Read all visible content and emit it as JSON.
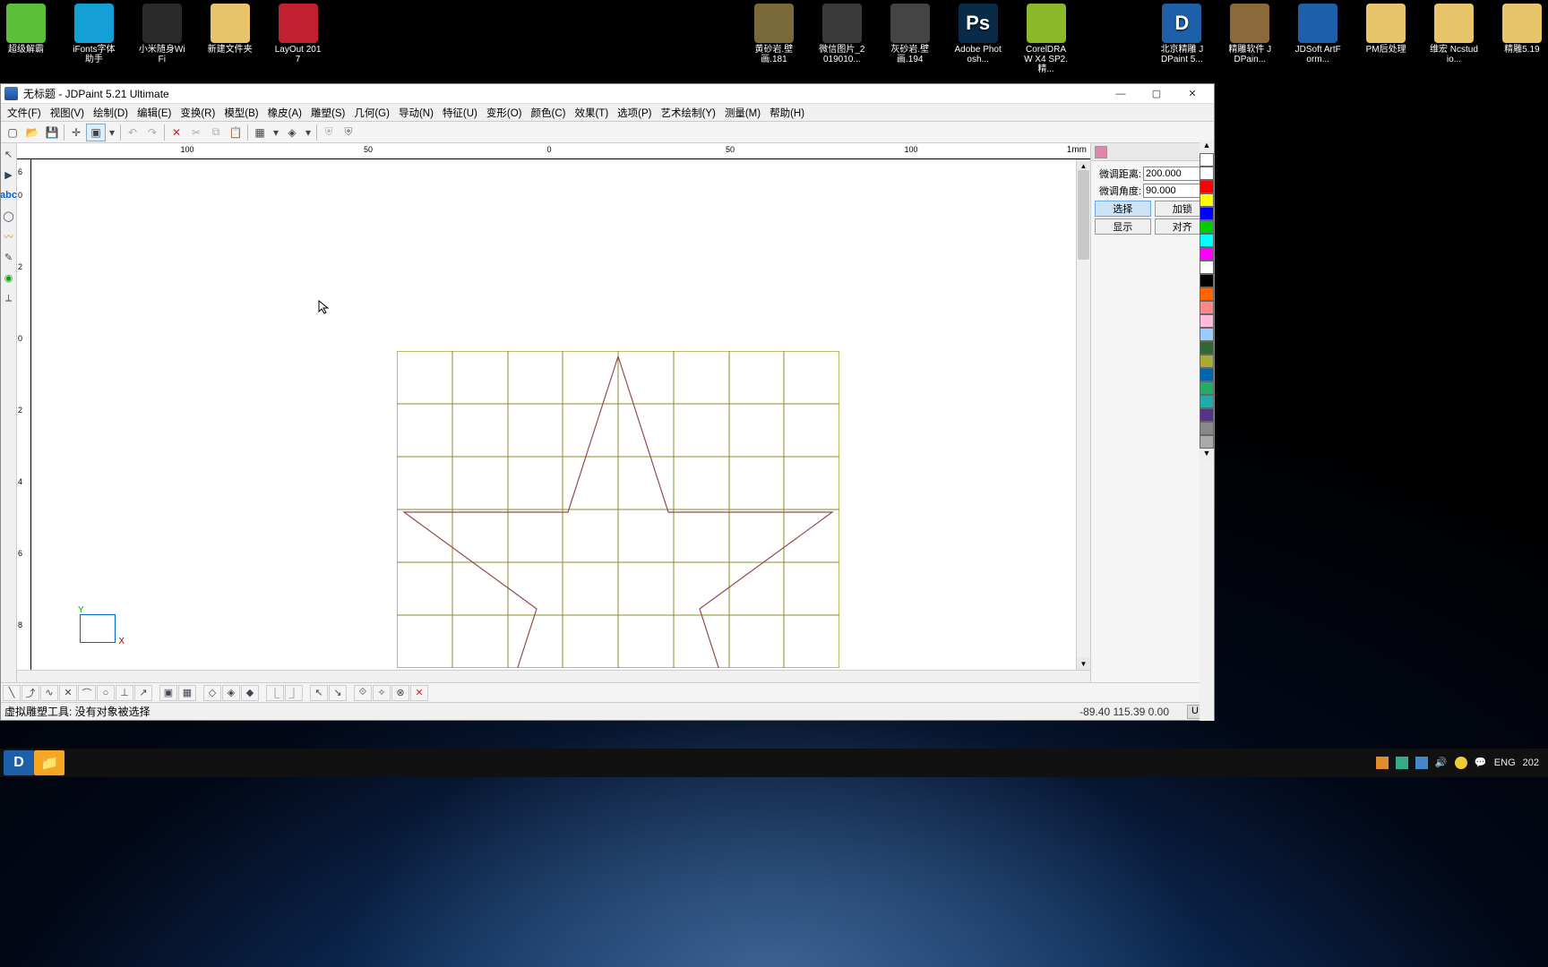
{
  "desktop_icons": [
    {
      "label": "超级解霸",
      "color": "#5bbf3a"
    },
    {
      "label": "iFonts字体助手",
      "color": "#14a0d6"
    },
    {
      "label": "小米随身WiFi",
      "color": "#2a2a2a"
    },
    {
      "label": "新建文件夹",
      "color": "#e8c46a"
    },
    {
      "label": "LayOut 2017",
      "color": "#c02030"
    },
    {
      "label": "",
      "color": "transparent"
    },
    {
      "label": "",
      "color": "transparent"
    },
    {
      "label": "",
      "color": "transparent"
    },
    {
      "label": "",
      "color": "transparent"
    },
    {
      "label": "",
      "color": "transparent"
    },
    {
      "label": "",
      "color": "transparent"
    },
    {
      "label": "黄砂岩.壁画.181",
      "color": "#7a6a3a"
    },
    {
      "label": "微信图片_2019010...",
      "color": "#3a3a3a"
    },
    {
      "label": "灰砂岩.壁画.194",
      "color": "#444"
    },
    {
      "label": "Adobe Photosh...",
      "color": "#0a2a4a",
      "text": "Ps"
    },
    {
      "label": "CorelDRAW X4 SP2.精...",
      "color": "#8ab82a"
    },
    {
      "label": "",
      "color": "transparent"
    },
    {
      "label": "北京精雕 JDPaint 5...",
      "color": "#1d5fa8",
      "text": "D"
    },
    {
      "label": "精雕软件 JDPain...",
      "color": "#8a6a3a"
    },
    {
      "label": "JDSoft ArtForm...",
      "color": "#1d5fa8"
    },
    {
      "label": "PM后处理",
      "color": "#e8c46a"
    },
    {
      "label": "维宏 Ncstudio...",
      "color": "#e8c46a"
    },
    {
      "label": "精雕5.19",
      "color": "#e8c46a"
    }
  ],
  "window": {
    "title": "无标题 - JDPaint 5.21 Ultimate",
    "menu": [
      "文件(F)",
      "视图(V)",
      "绘制(D)",
      "编辑(E)",
      "变换(R)",
      "模型(B)",
      "橡皮(A)",
      "雕塑(S)",
      "几何(G)",
      "导动(N)",
      "特征(U)",
      "变形(O)",
      "颜色(C)",
      "效果(T)",
      "选项(P)",
      "艺术绘制(Y)",
      "测量(M)",
      "帮助(H)"
    ]
  },
  "ruler": {
    "unit": "1mm",
    "h_ticks": [
      "100",
      "50",
      "0",
      "50",
      "100"
    ],
    "v_ticks": [
      "6",
      "0",
      "2",
      "0",
      "2",
      "4",
      "6",
      "8"
    ]
  },
  "right_panel": {
    "dist_label": "微调距离:",
    "dist_value": "200.000",
    "angle_label": "微调角度:",
    "angle_value": "90.000",
    "btn_select": "选择",
    "btn_lock": "加锁",
    "btn_show": "显示",
    "btn_align": "对齐"
  },
  "colors": [
    "#fff",
    "#fff",
    "#f00",
    "#ff0",
    "#00f",
    "#0c0",
    "#0ff",
    "#f0f",
    "#fff",
    "#000",
    "#f60",
    "#f88",
    "#fbd",
    "#9cf",
    "#363",
    "#aa3",
    "#06a",
    "#2a6",
    "#2aa",
    "#538",
    "#888",
    "#aaa"
  ],
  "origin": {
    "x": "X",
    "y": "Y"
  },
  "status": {
    "msg": "虚拟雕塑工具: 没有对象被选择",
    "coord": "-89.40  115.39  0.00",
    "u": "U"
  },
  "tray": {
    "lang": "ENG",
    "date": "202"
  }
}
